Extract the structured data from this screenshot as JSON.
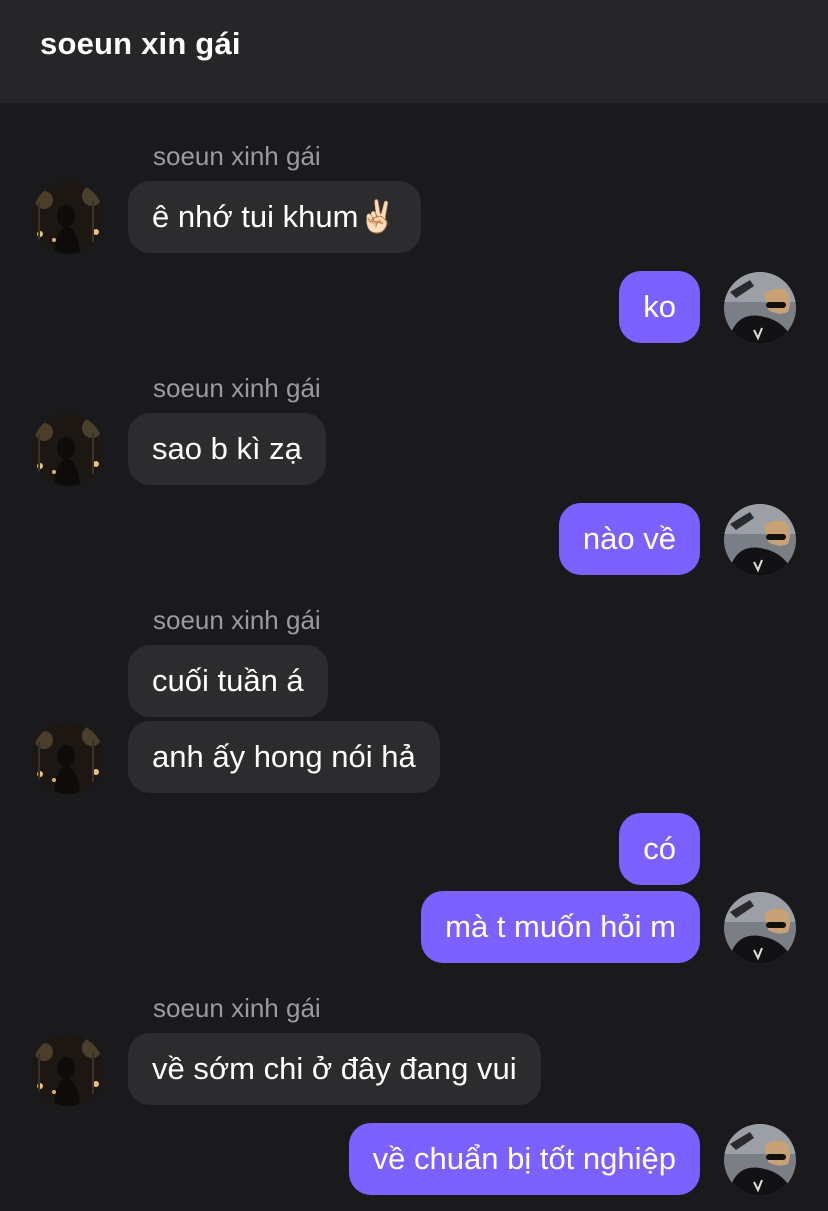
{
  "header": {
    "title": "soeun xin gái"
  },
  "sender_name": "soeun xinh gái",
  "messages": {
    "m1": "ê nhớ tui khum✌🏻",
    "m2": "ko",
    "m3": "sao b kì zạ",
    "m4": "nào về",
    "m5": "cuối tuần á",
    "m6": "anh ấy hong nói hả",
    "m7": "có",
    "m8": "mà t muốn hỏi m",
    "m9": "về sớm chi ở đây đang vui",
    "m10": "về chuẩn bị tốt nghiệp"
  },
  "colors": {
    "background": "#1a1a1d",
    "header": "#262628",
    "incoming_bubble": "#2c2c2f",
    "outgoing_bubble": "#7b61ff",
    "sender_name": "#9a9aa0"
  }
}
